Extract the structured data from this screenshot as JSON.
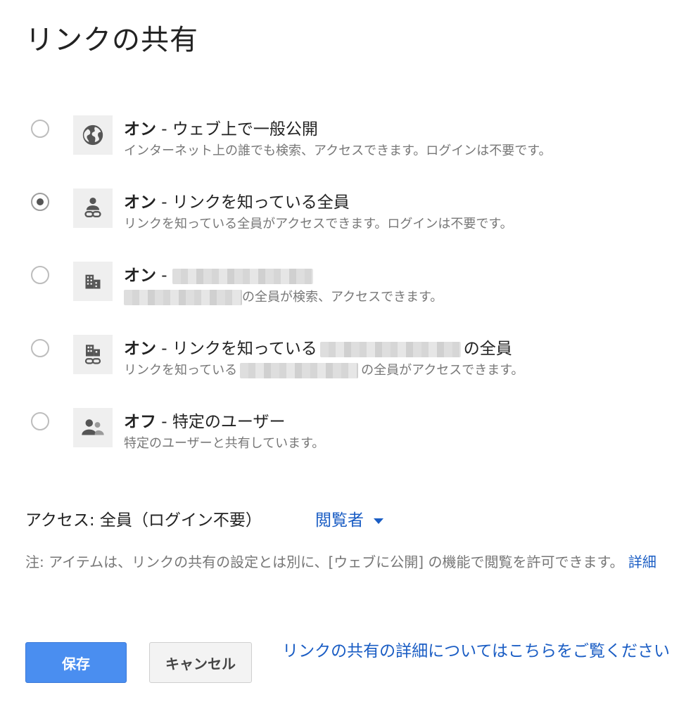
{
  "dialog": {
    "title": "リンクの共有"
  },
  "options": [
    {
      "state": "オン",
      "sep": " - ",
      "title": "ウェブ上で一般公開",
      "desc": "インターネット上の誰でも検索、アクセスできます。ログインは不要です。",
      "icon": "globe-icon",
      "selected": false
    },
    {
      "state": "オン",
      "sep": " - ",
      "title": "リンクを知っている全員",
      "desc": "リンクを知っている全員がアクセスできます。ログインは不要です。",
      "icon": "person-link-icon",
      "selected": true
    },
    {
      "state": "オン",
      "sep": " - ",
      "title": "",
      "desc_suffix": "の全員が検索、アクセスできます。",
      "icon": "building-icon",
      "selected": false
    },
    {
      "state": "オン",
      "sep": " - ",
      "title_prefix": "リンクを知っている",
      "title_suffix": "の全員",
      "desc_prefix": "リンクを知っている",
      "desc_suffix": "の全員がアクセスできます。",
      "icon": "building-link-icon",
      "selected": false
    },
    {
      "state": "オフ",
      "sep": " - ",
      "title": "特定のユーザー",
      "desc": "特定のユーザーと共有しています。",
      "icon": "people-icon",
      "selected": false
    }
  ],
  "access": {
    "label": "アクセス:  全員（ログイン不要）",
    "role": "閲覧者"
  },
  "note": {
    "text": "注: アイテムは、リンクの共有の設定とは別に、[ウェブに公開] の機能で閲覧を許可できます。",
    "link": "詳細"
  },
  "buttons": {
    "save": "保存",
    "cancel": "キャンセル"
  },
  "help_link": "リンクの共有の詳細についてはこちらをご覧ください",
  "colors": {
    "link": "#1a5dc4",
    "primary_button": "#4a8ef0"
  }
}
